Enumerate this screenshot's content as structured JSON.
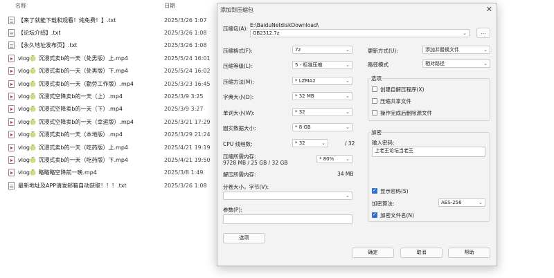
{
  "explorer": {
    "col_name": "名称",
    "col_date": "日期",
    "files": [
      {
        "name": "【来了就能下载和观看！纯免费！】.txt",
        "date": "2025/3/26 1:07",
        "type": "txt"
      },
      {
        "name": "【论坛介绍】.txt",
        "date": "2025/3/26 1:08",
        "type": "txt"
      },
      {
        "name": "【永久地址发布页】.txt",
        "date": "2025/3/26 1:08",
        "type": "txt"
      },
      {
        "name": "vlog🍈 沉浸式卖b的一天（处男版）上.mp4",
        "date": "2025/5/24 16:01",
        "type": "mp4"
      },
      {
        "name": "vlog🍈 沉浸式卖b的一天（处男版）下.mp4",
        "date": "2025/5/24 16:02",
        "type": "mp4"
      },
      {
        "name": "vlog🍈 沉浸式卖b的一天（勤劳工作版）.mp4",
        "date": "2025/3/23 16:45",
        "type": "mp4"
      },
      {
        "name": "vlog🍈 沉浸式空降卖b的一天（上）.mp4",
        "date": "2025/3/9 3:25",
        "type": "mp4"
      },
      {
        "name": "vlog🍈 沉浸式空降卖b的一天（下）.mp4",
        "date": "2025/3/9 3:27",
        "type": "mp4"
      },
      {
        "name": "vlog🍈 沉浸式空降卖b的一天（幸运版）.mp4",
        "date": "2025/3/21 17:29",
        "type": "mp4"
      },
      {
        "name": "vlog🍈 沉浸式卖b的一天（本地版）.mp4",
        "date": "2025/3/29 21:24",
        "type": "mp4"
      },
      {
        "name": "vlog🍈 沉浸式卖b的一天（吃药版）上.mp4",
        "date": "2025/4/21 19:19",
        "type": "mp4"
      },
      {
        "name": "vlog🍈 沉浸式卖b的一天（吃药版）下.mp4",
        "date": "2025/4/21 19:50",
        "type": "mp4"
      },
      {
        "name": "vlog🍈 略略略空降前一晚.mp4",
        "date": "2025/3/8 1:49",
        "type": "mp4"
      },
      {
        "name": "最新地址及APP请发邮箱自动获取！！！.txt",
        "date": "2025/3/26 1:08",
        "type": "txt"
      }
    ]
  },
  "dialog": {
    "title": "添加到压缩包",
    "close_glyph": "✕",
    "archive_label": "压缩包(A):",
    "archive_dir": "E:\\BaiduNetdiskDownload\\",
    "archive_name": "GB2312.7z",
    "browse_label": "...",
    "format_label": "压缩格式(F):",
    "format_value": "7z",
    "level_label": "压缩等级(L):",
    "level_value": "5 - 标准压缩",
    "method_label": "压缩方法(M):",
    "method_value": "* LZMA2",
    "dict_label": "字典大小(D):",
    "dict_value": "* 32 MB",
    "word_label": "单词大小(W):",
    "word_value": "* 32",
    "solid_label": "固实数据大小:",
    "solid_value": "* 8 GB",
    "cpu_label": "CPU 线程数:",
    "cpu_value": "* 32",
    "cpu_total": "/ 32",
    "mem_label": "压缩所需内存:",
    "mem_detail": "9728 MB / 25 GB / 32 GB",
    "mem_value": "* 80%",
    "decomp_label": "解压所需内存:",
    "decomp_value": "34 MB",
    "split_label": "分卷大小，字节(V):",
    "split_value": "",
    "params_label": "参数(P):",
    "params_value": "",
    "options_button": "选项",
    "update_label": "更新方式(U):",
    "update_value": "添加并替换文件",
    "path_label": "路径模式",
    "path_value": "相对路径",
    "options_group": "选项",
    "opt_sfx": "创建自解压程序(X)",
    "opt_shared": "压缩共享文件",
    "opt_delete": "操作完成后删除源文件",
    "encrypt_group": "加密",
    "password_label": "输入密码:",
    "password_value": "上老王论坛当老王",
    "show_password": "显示密码(S)",
    "enc_method_label": "加密算法:",
    "enc_method_value": "AES-256",
    "enc_names": "加密文件名(N)",
    "ok": "确定",
    "cancel": "取消",
    "help": "帮助"
  }
}
